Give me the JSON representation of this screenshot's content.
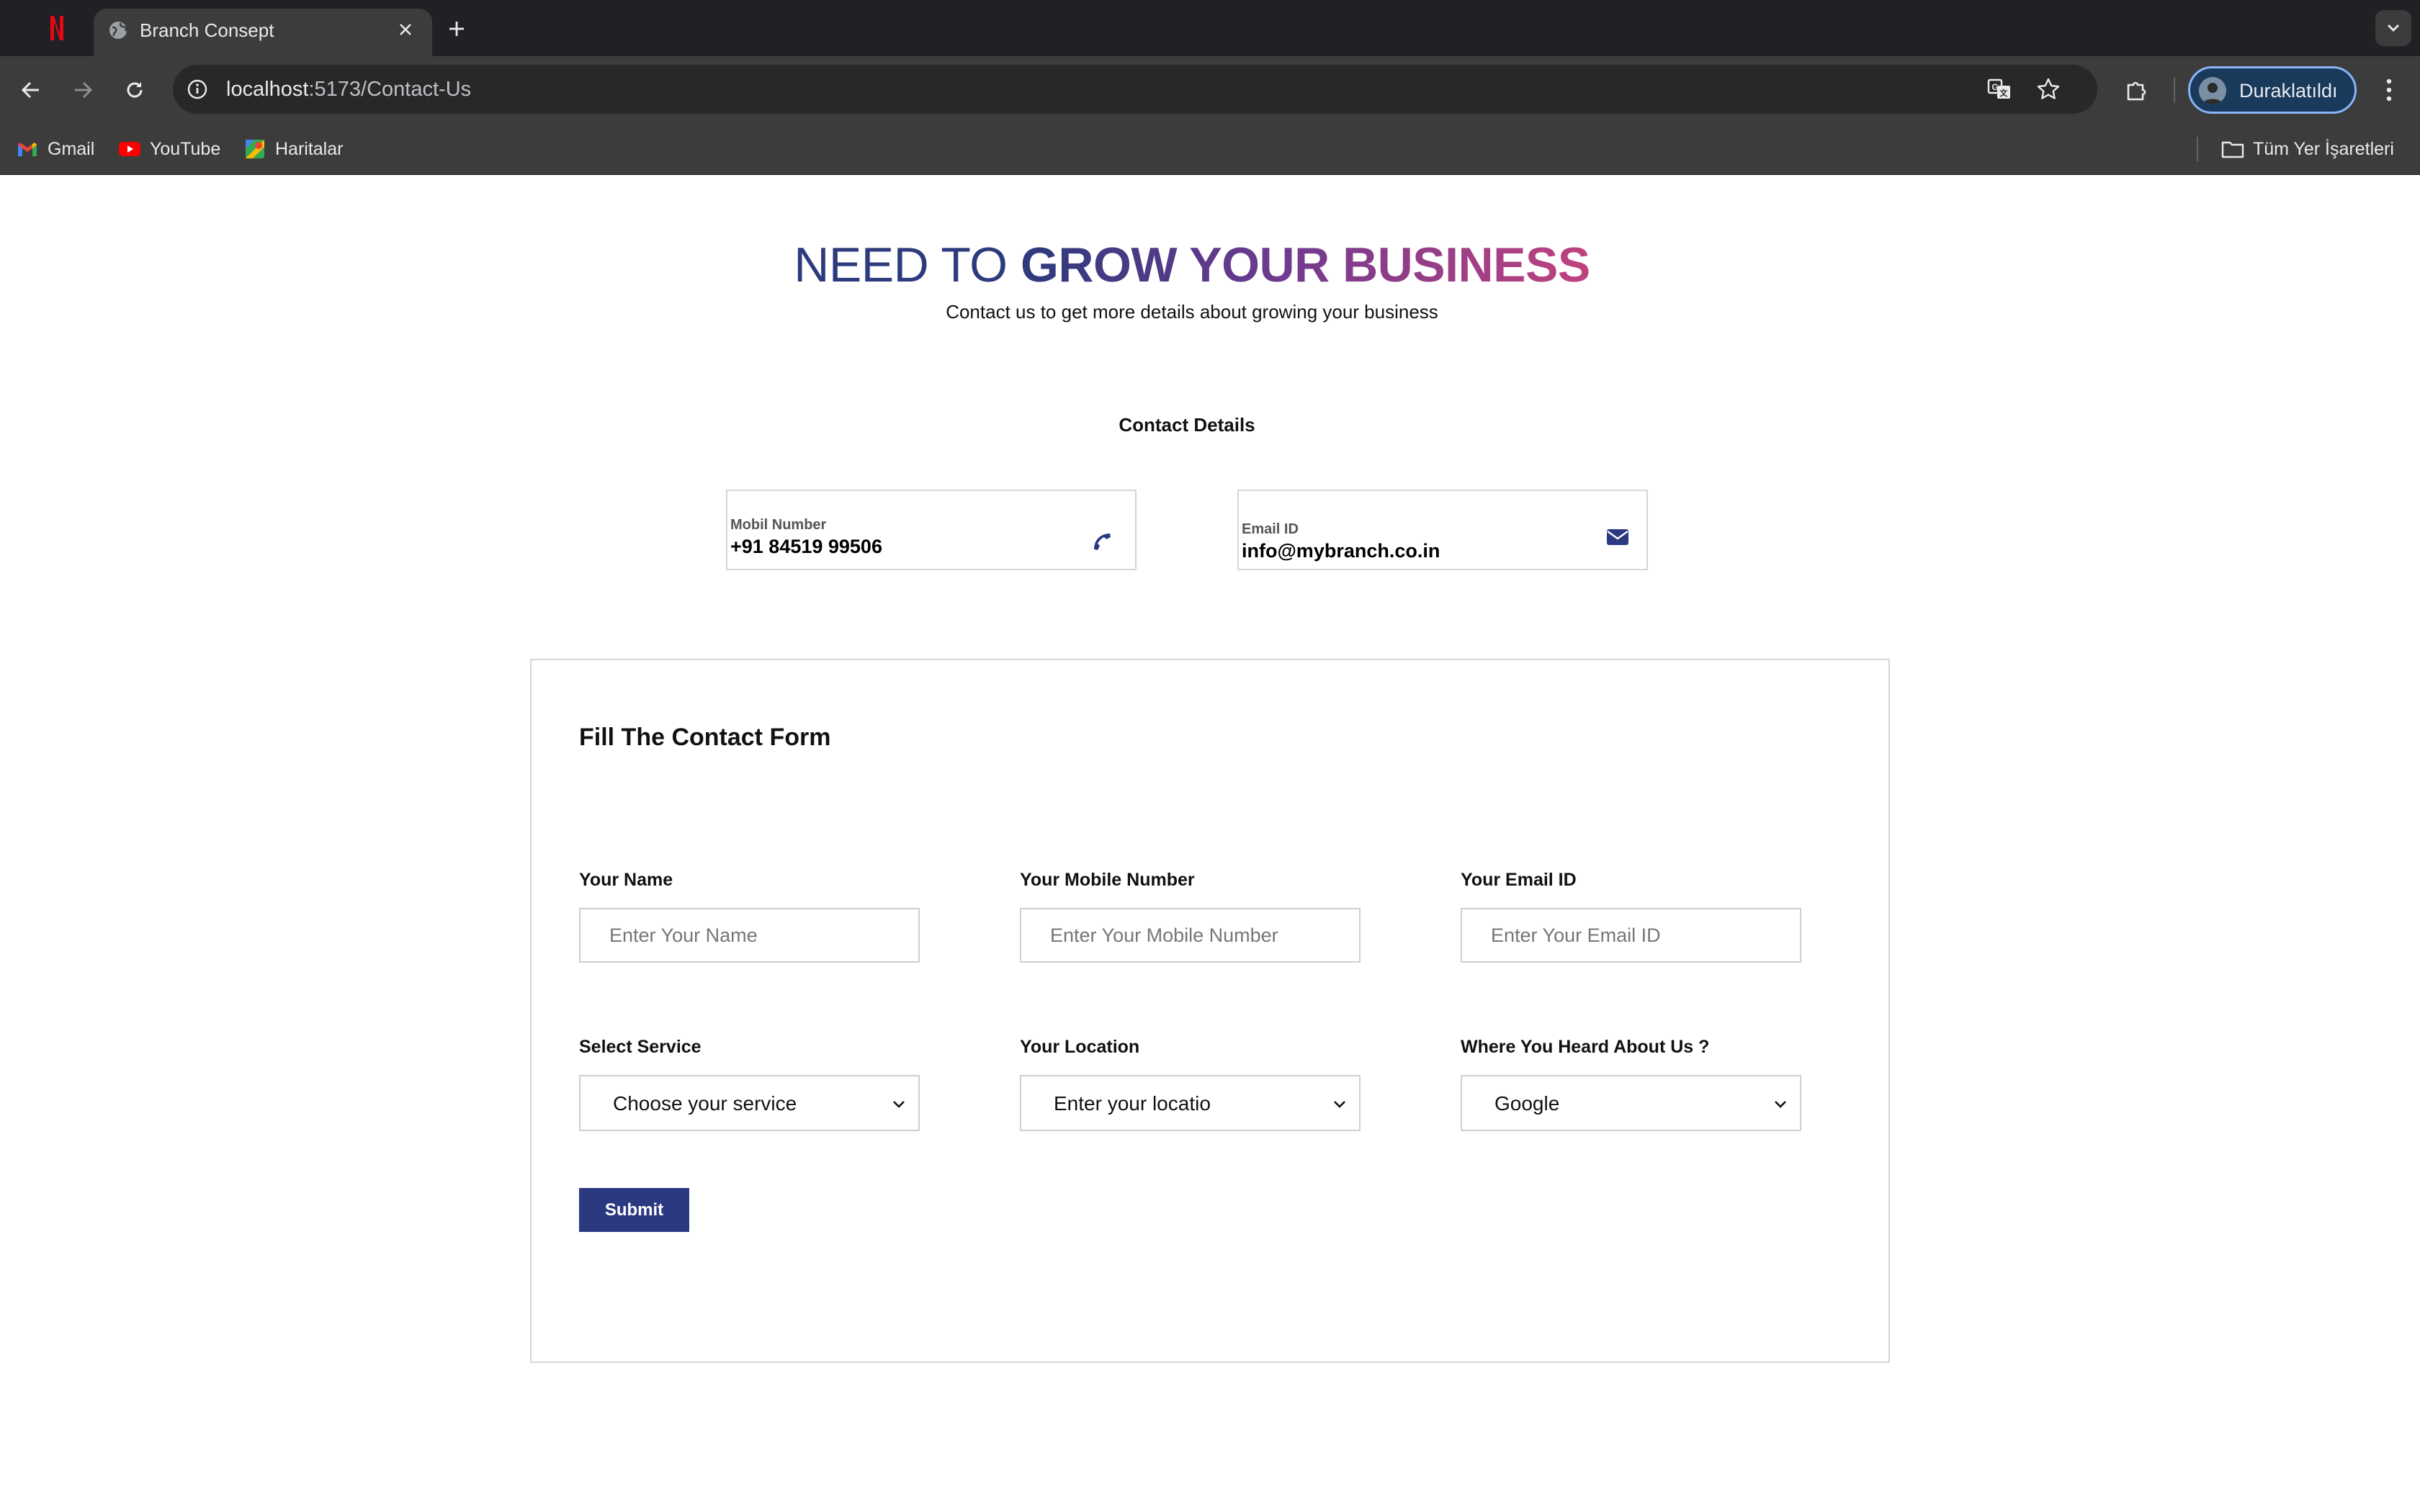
{
  "browser": {
    "tab_title": "Branch Consept",
    "url_host": "localhost",
    "url_rest": ":5173/Contact-Us",
    "profile_label": "Duraklatıldı",
    "bookmarks": [
      {
        "label": "Gmail",
        "icon": "gmail-icon"
      },
      {
        "label": "YouTube",
        "icon": "youtube-icon"
      },
      {
        "label": "Haritalar",
        "icon": "maps-icon"
      }
    ],
    "all_bookmarks_label": "Tüm Yer İşaretleri"
  },
  "hero": {
    "title_plain": "NEED TO ",
    "title_bold": "GROW YOUR BUSINESS",
    "subtitle": "Contact us to get more details about growing your business"
  },
  "contact": {
    "heading": "Contact Details",
    "phone": {
      "label": "Mobil Number",
      "value": "+91 84519 99506",
      "icon": "phone-icon"
    },
    "email": {
      "label": "Email ID",
      "value": "info@mybranch.co.in",
      "icon": "envelope-icon"
    }
  },
  "form": {
    "title": "Fill The Contact Form",
    "name": {
      "label": "Your Name",
      "placeholder": "Enter Your Name"
    },
    "mobile": {
      "label": "Your Mobile Number",
      "placeholder": "Enter Your Mobile Number"
    },
    "email": {
      "label": "Your Email ID",
      "placeholder": "Enter Your Email ID"
    },
    "service": {
      "label": "Select Service",
      "value": "Choose your service"
    },
    "location": {
      "label": "Your Location",
      "value": "Enter your locatio"
    },
    "heard": {
      "label": "Where You Heard About Us ?",
      "value": "Google"
    },
    "submit_label": "Submit"
  },
  "colors": {
    "brand_navy": "#2b3a80",
    "gradient_end": "#c0427f"
  }
}
